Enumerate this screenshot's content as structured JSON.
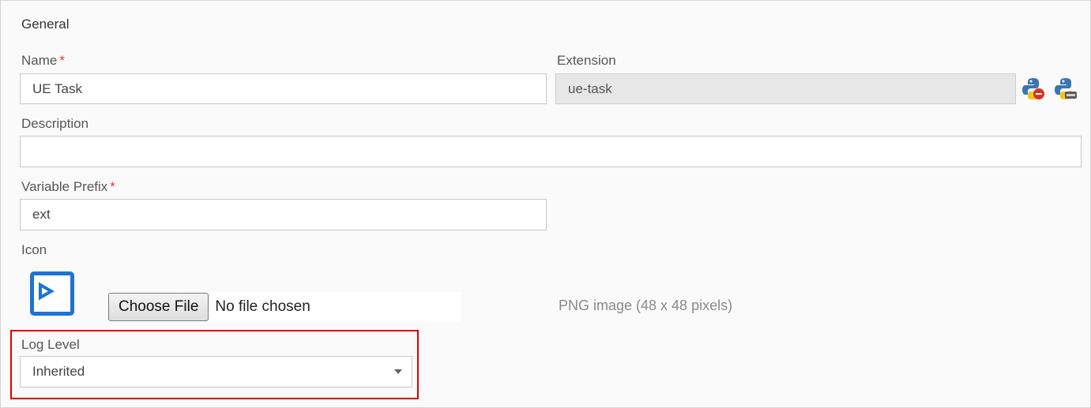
{
  "section": {
    "title": "General"
  },
  "required_marker": "*",
  "fields": {
    "name": {
      "label": "Name",
      "value": "UE Task"
    },
    "extension": {
      "label": "Extension",
      "value": "ue-task"
    },
    "description": {
      "label": "Description",
      "value": ""
    },
    "variable_prefix": {
      "label": "Variable Prefix",
      "value": "ext"
    },
    "icon": {
      "label": "Icon",
      "choose_button": "Choose File",
      "file_status": "No file chosen",
      "hint": "PNG image (48 x 48 pixels)"
    },
    "log_level": {
      "label": "Log Level",
      "value": "Inherited"
    }
  },
  "icons": {
    "extension_action_1": "python-remove-icon",
    "extension_action_2": "python-download-icon",
    "icon_preview": "terminal-prompt-icon",
    "dropdown": "caret-down-icon"
  },
  "colors": {
    "required": "#e53935",
    "icon_blue": "#1e73d4",
    "highlight": "#e00000",
    "python_blue": "#3a75b0",
    "python_yellow": "#f5c518",
    "remove_red": "#d93025"
  }
}
